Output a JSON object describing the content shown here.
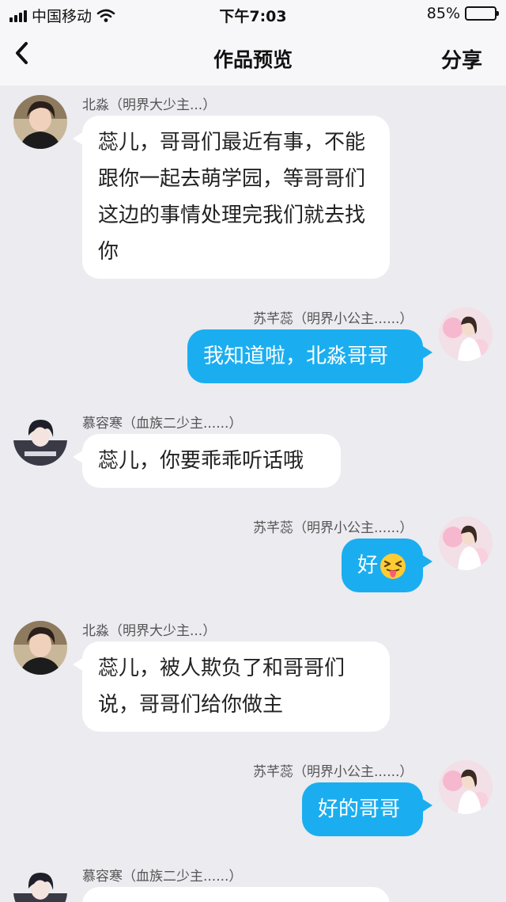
{
  "status_bar": {
    "carrier": "中国移动",
    "time": "下午7:03",
    "battery": "85%",
    "battery_level": 0.85
  },
  "nav": {
    "title": "作品预览",
    "share": "分享"
  },
  "messages": [
    {
      "side": "in",
      "speaker": "北淼（明界大少主...）",
      "text": "蕊儿，哥哥们最近有事，不能跟你一起去萌学园，等哥哥们这边的事情处理完我们就去找你",
      "avatar": "beimiao-avatar"
    },
    {
      "side": "out",
      "speaker": "苏芊蕊（明界小公主......）",
      "text": "我知道啦，北淼哥哥",
      "avatar": "suqianrui-avatar"
    },
    {
      "side": "in",
      "speaker": "慕容寒（血族二少主......）",
      "text": "蕊儿，你要乖乖听话哦",
      "avatar": "murongHan-avatar"
    },
    {
      "side": "out",
      "speaker": "苏芊蕊（明界小公主......）",
      "text": "好",
      "emoji": "squinting-tongue-emoji",
      "avatar": "suqianrui-avatar"
    },
    {
      "side": "in",
      "speaker": "北淼（明界大少主...）",
      "text": "蕊儿，被人欺负了和哥哥们说，哥哥们给你做主",
      "avatar": "beimiao-avatar"
    },
    {
      "side": "out",
      "speaker": "苏芊蕊（明界小公主......）",
      "text": "好的哥哥",
      "avatar": "suqianrui-avatar"
    },
    {
      "side": "in",
      "speaker": "慕容寒（血族二少主......）",
      "text": "",
      "avatar": "murongHan-avatar"
    }
  ],
  "colors": {
    "background": "#ebebf0",
    "outgoing_bubble": "#1aaef0",
    "incoming_bubble": "#ffffff"
  }
}
